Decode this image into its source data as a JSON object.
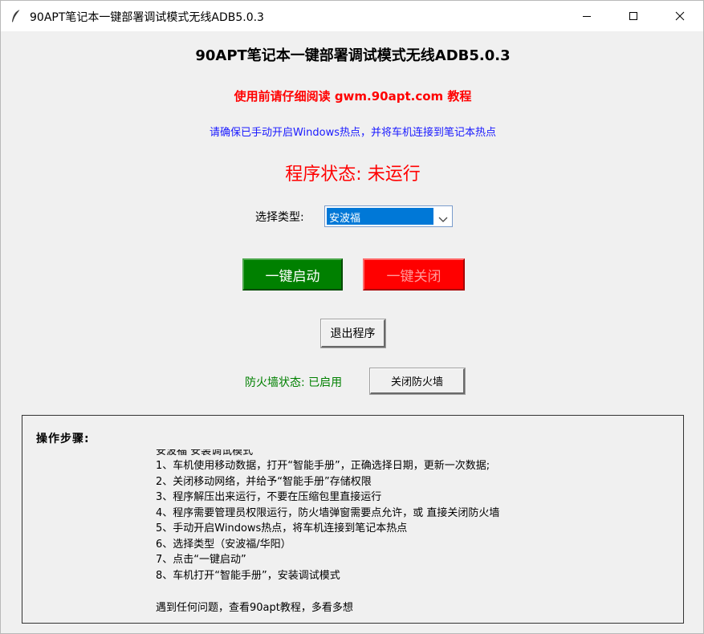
{
  "window": {
    "title": "90APT笔记本一键部署调试模式无线ADB5.0.3",
    "icon": "feather-icon"
  },
  "header": {
    "app_title": "90APT笔记本一键部署调试模式无线ADB5.0.3",
    "warning": "使用前请仔细阅读 gwm.90apt.com 教程",
    "hint": "请确保已手动开启Windows热点，并将车机连接到笔记本热点",
    "status": "程序状态: 未运行"
  },
  "type_select": {
    "label": "选择类型:",
    "value": "安波福"
  },
  "buttons": {
    "start": "一键启动",
    "stop": "一键关闭",
    "exit": "退出程序",
    "firewall_off": "关闭防火墙"
  },
  "firewall": {
    "status": "防火墙状态: 已启用"
  },
  "steps": {
    "title": "操作步骤:",
    "subtitle": "安波福 安装调试模式",
    "items": [
      "1、车机使用移动数据，打开“智能手册”，正确选择日期，更新一次数据;",
      "2、关闭移动网络，并给予“智能手册”存储权限",
      "3、程序解压出来运行，不要在压缩包里直接运行",
      "4、程序需要管理员权限运行，防火墙弹窗需要点允许，或 直接关闭防火墙",
      "5、手动开启Windows热点，将车机连接到笔记本热点",
      "6、选择类型（安波福/华阳）",
      "7、点击“一键启动”",
      "8、车机打开“智能手册”，安装调试模式"
    ],
    "footer": "遇到任何问题，查看90apt教程，多看多想"
  },
  "colors": {
    "start_button": "#008000",
    "stop_button": "#ff0000",
    "status_text": "#ff0000",
    "hint_text": "#1a1aff",
    "firewall_text": "#008000",
    "select_highlight": "#0078d7"
  }
}
